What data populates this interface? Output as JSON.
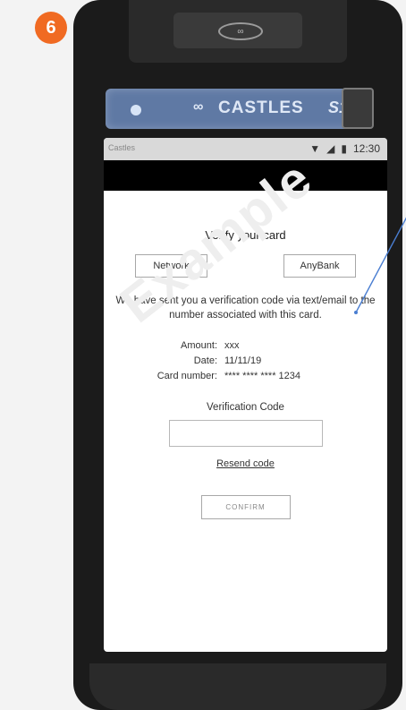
{
  "step": {
    "number": "6"
  },
  "device": {
    "brand": "CASTLES",
    "model": "S1",
    "brand_mark": "∞"
  },
  "screen": {
    "status": {
      "left_text": "Castles",
      "time": "12:30"
    },
    "title": "Verify your card",
    "buttons": {
      "network": "Network",
      "bank": "AnyBank"
    },
    "message": "We have sent you a verification code via text/email to the number associated with this card.",
    "details": [
      {
        "label": "Amount:",
        "value": "xxx"
      },
      {
        "label": "Date:",
        "value": "11/11/19"
      },
      {
        "label": "Card number:",
        "value": "**** **** **** 1234"
      }
    ],
    "verification_code_label": "Verification Code",
    "verification_code_value": "",
    "resend_code": "Resend code",
    "confirm": "CONFIRM"
  },
  "watermark": "Example",
  "colors": {
    "badge": "#f06a22",
    "callout_line": "#4a7ed1"
  }
}
